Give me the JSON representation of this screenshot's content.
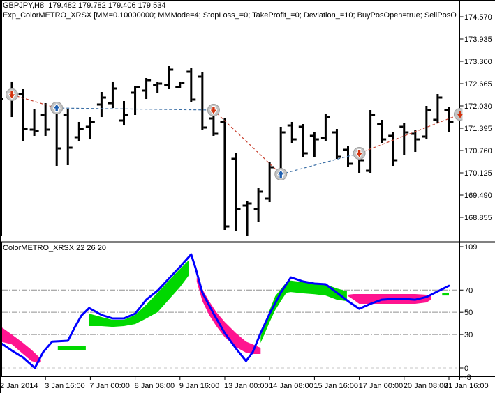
{
  "header": {
    "symbol_line": "GBPJPY,H8  179.482 179.782 179.406 179.534",
    "ea_line": "Exp_ColorMETRO_XRSX [MM=0.10000000; MMMode=4; StopLoss_=0; TakeProfit_=0; Deviation_=10; BuyPosOpen=true; SellPosOpen=true; BuyPosClos"
  },
  "indicator_panel": {
    "label": "ColorMETRO_XRSX 22 26 20"
  },
  "colors": {
    "background": "#ffffff",
    "bars": "#000000",
    "axis_text": "#000000",
    "indicator_line": "#0000ff",
    "band_bull": "#00d800",
    "band_bear": "#ff1490",
    "trend_sell": "#c8402e",
    "trend_buy": "#3a6ea5",
    "arrow_sell": "#d2330f",
    "arrow_buy": "#1f5fb0",
    "marker_fill": "#c4c4c4",
    "marker_edge": "#9e9e9e",
    "level_line": "#909090",
    "zero_line": "#c4c4c4",
    "frame": "#000000"
  },
  "chart_data": [
    {
      "type": "ohlc_bars",
      "title": "GBPJPY,H8",
      "y_axis": {
        "labels": [
          "174.570",
          "173.935",
          "173.300",
          "172.665",
          "172.030",
          "171.395",
          "170.760",
          "170.125",
          "169.490",
          "168.855"
        ]
      },
      "x_axis": {
        "labels": [
          "2 Jan 2014",
          "3 Jan 16:00",
          "7 Jan 00:00",
          "8 Jan 08:00",
          "9 Jan 16:00",
          "13 Jan 00:00",
          "14 Jan 08:00",
          "15 Jan 16:00",
          "17 Jan 00:00",
          "20 Jan 08:00",
          "21 Jan 16:00"
        ]
      },
      "left_edge_prev_close": 172.228,
      "bars": [
        [
          172.387,
          172.725,
          171.712,
          172.268
        ],
        [
          172.367,
          172.506,
          171.018,
          171.375
        ],
        [
          171.355,
          171.931,
          171.177,
          171.316
        ],
        [
          171.772,
          172.109,
          171.177,
          171.355
        ],
        [
          171.911,
          172.07,
          170.323,
          170.819
        ],
        [
          171.772,
          171.931,
          170.343,
          170.839
        ],
        [
          171.137,
          171.574,
          171.038,
          171.375
        ],
        [
          171.435,
          171.712,
          171.077,
          171.574
        ],
        [
          172.07,
          172.427,
          171.712,
          172.268
        ],
        [
          172.109,
          172.725,
          171.97,
          172.526
        ],
        [
          171.613,
          172.169,
          171.474,
          171.772
        ],
        [
          172.407,
          172.605,
          171.772,
          172.566
        ],
        [
          172.467,
          172.824,
          172.228,
          172.764
        ],
        [
          172.625,
          172.705,
          172.407,
          172.665
        ],
        [
          172.625,
          173.161,
          172.506,
          173.062
        ],
        [
          172.566,
          172.725,
          172.526,
          172.685
        ],
        [
          173.002,
          173.102,
          172.129,
          172.209
        ],
        [
          172.863,
          173.002,
          171.336,
          171.415
        ],
        [
          171.673,
          171.812,
          171.177,
          171.236
        ],
        [
          171.574,
          171.673,
          168.498,
          168.597
        ],
        [
          170.522,
          170.681,
          168.458,
          169.093
        ],
        [
          169.192,
          169.331,
          168.339,
          169.252
        ],
        [
          169.093,
          169.688,
          168.736,
          169.589
        ],
        [
          169.391,
          170.442,
          169.291,
          170.284
        ],
        [
          170.125,
          171.435,
          170.045,
          171.276
        ],
        [
          171.474,
          171.574,
          170.978,
          171.077
        ],
        [
          171.435,
          171.514,
          170.581,
          170.681
        ],
        [
          171.177,
          171.276,
          170.581,
          171.077
        ],
        [
          171.117,
          171.812,
          171.018,
          171.712
        ],
        [
          171.276,
          171.375,
          170.522,
          170.581
        ],
        [
          170.78,
          170.879,
          170.284,
          170.383
        ],
        [
          170.641,
          170.72,
          170.125,
          170.482
        ],
        [
          170.184,
          171.911,
          170.125,
          171.772
        ],
        [
          171.514,
          171.633,
          170.978,
          171.077
        ],
        [
          171.177,
          171.276,
          170.323,
          170.482
        ],
        [
          171.435,
          171.534,
          170.641,
          171.276
        ],
        [
          171.236,
          171.336,
          170.72,
          171.077
        ],
        [
          171.157,
          172.03,
          171.077,
          171.911
        ],
        [
          171.633,
          172.367,
          171.534,
          172.268
        ],
        [
          171.911,
          172.01,
          171.276,
          171.574
        ]
      ],
      "signals": [
        {
          "bar": 0,
          "type": "sell",
          "price": 172.35
        },
        {
          "bar": 4,
          "type": "buy",
          "price": 171.97
        },
        {
          "bar": 18,
          "type": "sell",
          "price": 171.911
        },
        {
          "bar": 24,
          "type": "buy",
          "price": 170.085
        },
        {
          "bar": 31,
          "type": "sell",
          "price": 170.681
        },
        {
          "bar": 40,
          "type": "pending",
          "price": 171.79
        }
      ],
      "trend_segments": [
        {
          "from": 0,
          "to": 1,
          "style": "sell"
        },
        {
          "from": 1,
          "to": 2,
          "style": "buy"
        },
        {
          "from": 2,
          "to": 3,
          "style": "sell"
        },
        {
          "from": 3,
          "to": 4,
          "style": "buy"
        },
        {
          "from": 4,
          "to": 5,
          "style": "sell"
        }
      ]
    },
    {
      "type": "oscillator_line_with_bands",
      "name": "ColorMETRO_XRSX",
      "params": "22 26 20",
      "y_axis": {
        "labels": [
          "109",
          "70",
          "50",
          "30",
          "0",
          "-8"
        ],
        "range": [
          -8,
          112
        ]
      },
      "levels": {
        "dash_dot": [
          70,
          50,
          30
        ],
        "dashed": [
          0
        ]
      },
      "line": [
        [
          -1,
          22.5
        ],
        [
          0,
          15.6
        ],
        [
          1,
          9.4
        ],
        [
          2.05,
          0.0
        ],
        [
          2.8,
          14.3
        ],
        [
          3.6,
          23.7
        ],
        [
          5,
          24.4
        ],
        [
          5.6,
          36.3
        ],
        [
          6.2,
          46.9
        ],
        [
          6.9,
          53.9
        ],
        [
          8,
          47.6
        ],
        [
          9,
          44.5
        ],
        [
          10,
          44.5
        ],
        [
          11,
          48.8
        ],
        [
          12,
          61.4
        ],
        [
          13,
          69.5
        ],
        [
          14,
          80.2
        ],
        [
          15,
          90.8
        ],
        [
          16,
          102.1
        ],
        [
          16.4,
          89.6
        ],
        [
          17,
          67.6
        ],
        [
          18,
          48.8
        ],
        [
          19,
          31.3
        ],
        [
          20,
          17.5
        ],
        [
          20.9,
          6.2
        ],
        [
          21.5,
          14.3
        ],
        [
          22.2,
          31.3
        ],
        [
          23,
          48.8
        ],
        [
          24,
          67.6
        ],
        [
          24.9,
          81.4
        ],
        [
          26,
          77.7
        ],
        [
          27,
          75.8
        ],
        [
          28,
          75.2
        ],
        [
          29,
          67.6
        ],
        [
          30,
          60.1
        ],
        [
          31,
          53.2
        ],
        [
          32,
          57.6
        ],
        [
          33,
          61.3
        ],
        [
          34,
          62.0
        ],
        [
          35,
          62.0
        ],
        [
          36,
          61.3
        ],
        [
          37,
          63.8
        ],
        [
          38,
          68.8
        ],
        [
          39,
          73.8
        ]
      ],
      "bands": {
        "bull": [
          [
            [
              4.1,
              19.4,
              16.3
            ],
            [
              6.6,
              19.4,
              16.3
            ]
          ],
          [
            [
              6.9,
              48.8,
              37.6
            ],
            [
              8,
              45.7,
              37.6
            ],
            [
              9,
              43.2,
              36.9
            ],
            [
              10,
              43.2,
              37.6
            ],
            [
              11,
              47.6,
              39.4
            ],
            [
              12,
              57.0,
              44.5
            ],
            [
              13,
              67.6,
              50.1
            ],
            [
              14,
              78.4,
              61.3
            ],
            [
              15,
              88.9,
              72.6
            ],
            [
              15.8,
              97.0,
              83.3
            ]
          ],
          [
            [
              22.2,
              28.2,
              22.5
            ],
            [
              23,
              52.0,
              41.3
            ],
            [
              23.5,
              64.5,
              52.0
            ],
            [
              24,
              70.7,
              60.1
            ],
            [
              24.5,
              77.1,
              67.6
            ],
            [
              24.9,
              78.4,
              68.2
            ],
            [
              26,
              77.1,
              67.0
            ],
            [
              27,
              75.8,
              66.3
            ],
            [
              28,
              75.2,
              65.1
            ],
            [
              29,
              71.4,
              61.3
            ],
            [
              29.9,
              68.9,
              60.1
            ]
          ],
          [
            [
              38.4,
              67.0,
              65.1
            ],
            [
              39,
              67.0,
              65.1
            ]
          ]
        ],
        "bear": [
          [
            [
              -1.06,
              37.6,
              23.8
            ],
            [
              0,
              30.0,
              21.2
            ],
            [
              1,
              22.5,
              12.5
            ],
            [
              1.75,
              16.3,
              6.2
            ],
            [
              2.4,
              10.0,
              4.4
            ],
            [
              2.6,
              7.5,
              5.6
            ]
          ],
          [
            [
              16.5,
              81.4,
              77.7
            ],
            [
              17,
              70.7,
              60.1
            ],
            [
              17.6,
              60.1,
              47.6
            ],
            [
              18.25,
              50.1,
              37.5
            ],
            [
              19,
              41.3,
              27.6
            ],
            [
              20,
              31.3,
              18.7
            ],
            [
              20.9,
              23.7,
              13.7
            ],
            [
              21.5,
              21.2,
              12.5
            ],
            [
              22.2,
              18.0,
              12.5
            ]
          ],
          [
            [
              30,
              65.8,
              64.5
            ],
            [
              30.5,
              66.4,
              61.3
            ],
            [
              31,
              66.4,
              57.6
            ],
            [
              33,
              66.4,
              57.6
            ],
            [
              35,
              66.4,
              57.6
            ],
            [
              36,
              66.4,
              57.6
            ],
            [
              37,
              65.8,
              58.9
            ],
            [
              37.4,
              65.1,
              61.3
            ]
          ]
        ]
      }
    }
  ]
}
